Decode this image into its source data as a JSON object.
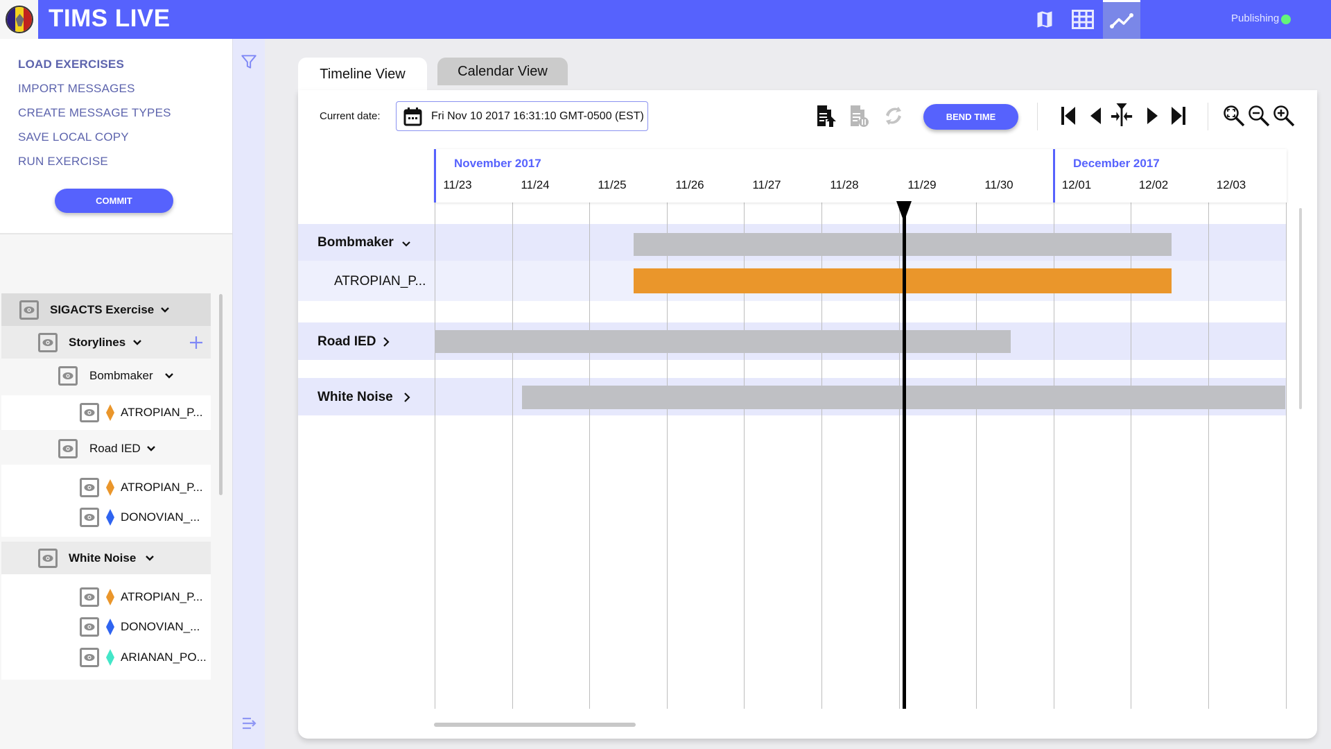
{
  "app": {
    "title": "TIMS LIVE",
    "status_text": "Publishing",
    "status_color": "#63f47a",
    "accent_color": "#5662fd",
    "header_icons": [
      {
        "name": "map-icon",
        "active": false
      },
      {
        "name": "table-grid-icon",
        "active": false
      },
      {
        "name": "timeline-chart-icon",
        "active": true
      }
    ]
  },
  "menu": {
    "items": [
      {
        "label": "LOAD EXERCISES",
        "bold": true
      },
      {
        "label": "IMPORT MESSAGES",
        "bold": false
      },
      {
        "label": "CREATE MESSAGE TYPES",
        "bold": false
      },
      {
        "label": "SAVE LOCAL COPY",
        "bold": false
      },
      {
        "label": "RUN EXERCISE",
        "bold": false
      }
    ],
    "commit_label": "COMMIT"
  },
  "tree": {
    "root": {
      "label": "SIGACTS Exercise",
      "expanded": true
    },
    "storylines": {
      "label": "Storylines",
      "expanded": true
    },
    "groups": [
      {
        "label": "Bombmaker",
        "expanded": true,
        "items": [
          {
            "label": "ATROPIAN_P...",
            "color": "#ea962b"
          }
        ]
      },
      {
        "label": "Road IED",
        "expanded": true,
        "items": [
          {
            "label": "ATROPIAN_P...",
            "color": "#ea962b"
          },
          {
            "label": "DONOVIAN_...",
            "color": "#2f64f0"
          }
        ]
      },
      {
        "label": "White Noise",
        "expanded": true,
        "items": [
          {
            "label": "ATROPIAN_P...",
            "color": "#ea962b"
          },
          {
            "label": "DONOVIAN_...",
            "color": "#2f64f0"
          },
          {
            "label": "ARIANAN_PO...",
            "color": "#43e6c8"
          }
        ]
      }
    ]
  },
  "tabs": [
    {
      "label": "Timeline View",
      "active": true
    },
    {
      "label": "Calendar View",
      "active": false
    }
  ],
  "toolbar": {
    "current_date_label": "Current date:",
    "current_date_value": "Fri Nov 10 2017 16:31:10 GMT-0500 (EST)",
    "bend_time_label": "BEND TIME"
  },
  "timeline": {
    "months": [
      {
        "label": "November 2017",
        "start_day_index": 0
      },
      {
        "label": "December 2017",
        "start_day_index": 8
      }
    ],
    "days": [
      "11/23",
      "11/24",
      "11/25",
      "11/26",
      "11/27",
      "11/28",
      "11/29",
      "11/30",
      "12/01",
      "12/02",
      "12/03"
    ],
    "current_time_day_offset": 6.07,
    "rows": [
      {
        "label": "Bombmaker",
        "bold": true,
        "chevron": "down",
        "bar": {
          "start": 2.57,
          "end": 9.52,
          "color": "#bfc0c4"
        }
      },
      {
        "label": "ATROPIAN_P...",
        "bold": false,
        "chevron": null,
        "bar": {
          "start": 2.57,
          "end": 9.52,
          "color": "#ea962b"
        }
      },
      {
        "label": "Road IED",
        "bold": true,
        "chevron": "right",
        "bar": {
          "start": 0.0,
          "end": 7.45,
          "color": "#bfc0c4"
        }
      },
      {
        "label": "White Noise",
        "bold": true,
        "chevron": "right",
        "bar": {
          "start": 1.13,
          "end": 11.0,
          "color": "#bfc0c4"
        }
      }
    ]
  }
}
